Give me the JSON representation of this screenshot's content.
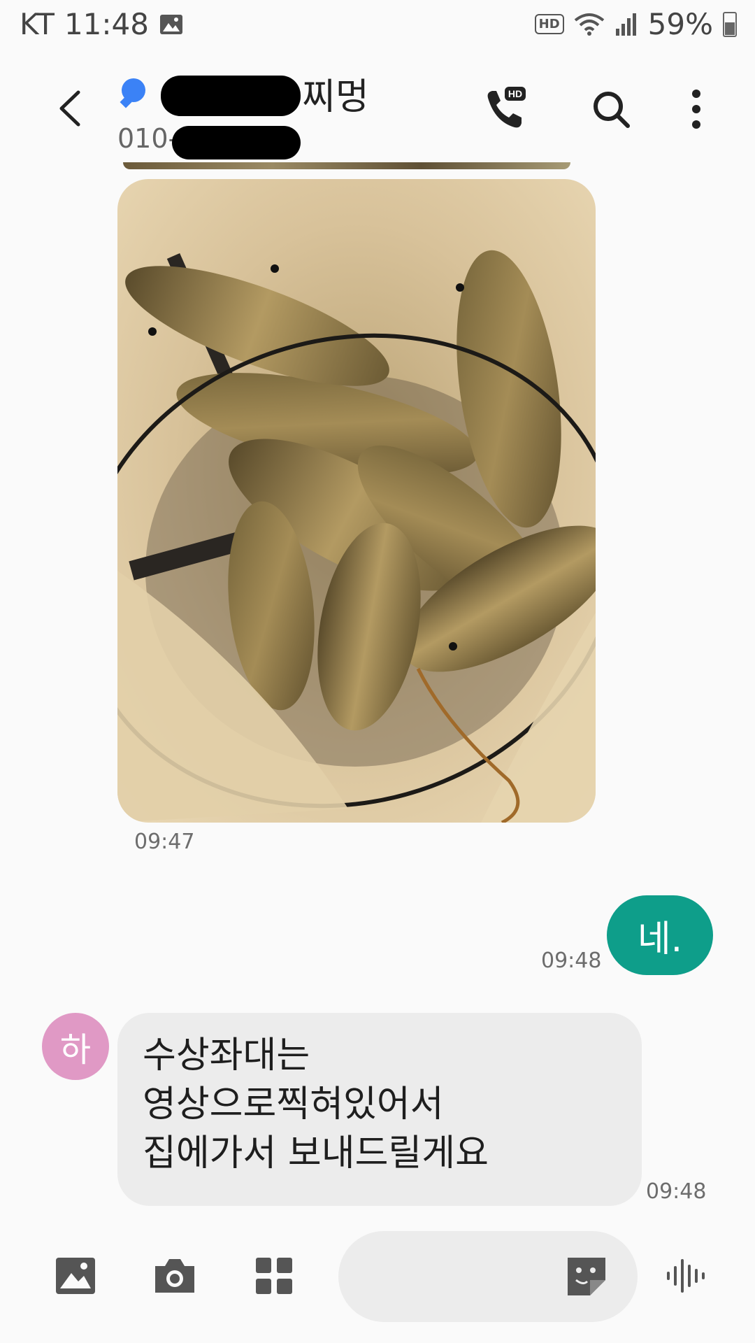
{
  "status_bar": {
    "carrier": "KT",
    "time": "11:48",
    "hd_badge": "HD",
    "battery": "59%"
  },
  "header": {
    "contact_name_suffix": "찌멍",
    "phone_prefix": "010-",
    "call_badge": "HD"
  },
  "messages": [
    {
      "type": "image",
      "direction": "incoming",
      "time": "09:47",
      "description_icon": "photo"
    },
    {
      "type": "text",
      "direction": "outgoing",
      "text": "네.",
      "time": "09:48"
    },
    {
      "type": "text",
      "direction": "incoming",
      "avatar_initial": "하",
      "lines": [
        "수상좌대는",
        "영상으로찍혀있어서",
        "집에가서 보내드릴게요"
      ],
      "time": "09:48"
    }
  ],
  "colors": {
    "outgoing_bubble": "#0e9e8a",
    "incoming_bubble": "#ececec",
    "avatar": "#e099c5",
    "presence": "#3b82f6"
  }
}
